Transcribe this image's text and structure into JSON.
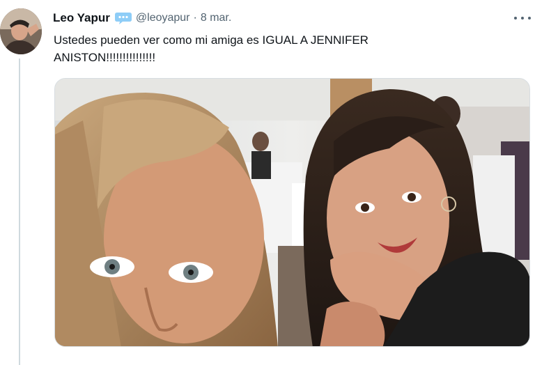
{
  "tweet": {
    "author_name": "Leo Yapur",
    "handle": "@leoyapur",
    "separator": "·",
    "date": "8 mar.",
    "text": "Ustedes pueden ver como mi amiga es IGUAL A JENNIFER\nANISTON!!!!!!!!!!!!!!!"
  },
  "icons": {
    "badge": "speech-bubble-icon",
    "more": "more-options-icon"
  },
  "colors": {
    "accent": "#1d9bf0",
    "secondary_text": "#536471"
  }
}
